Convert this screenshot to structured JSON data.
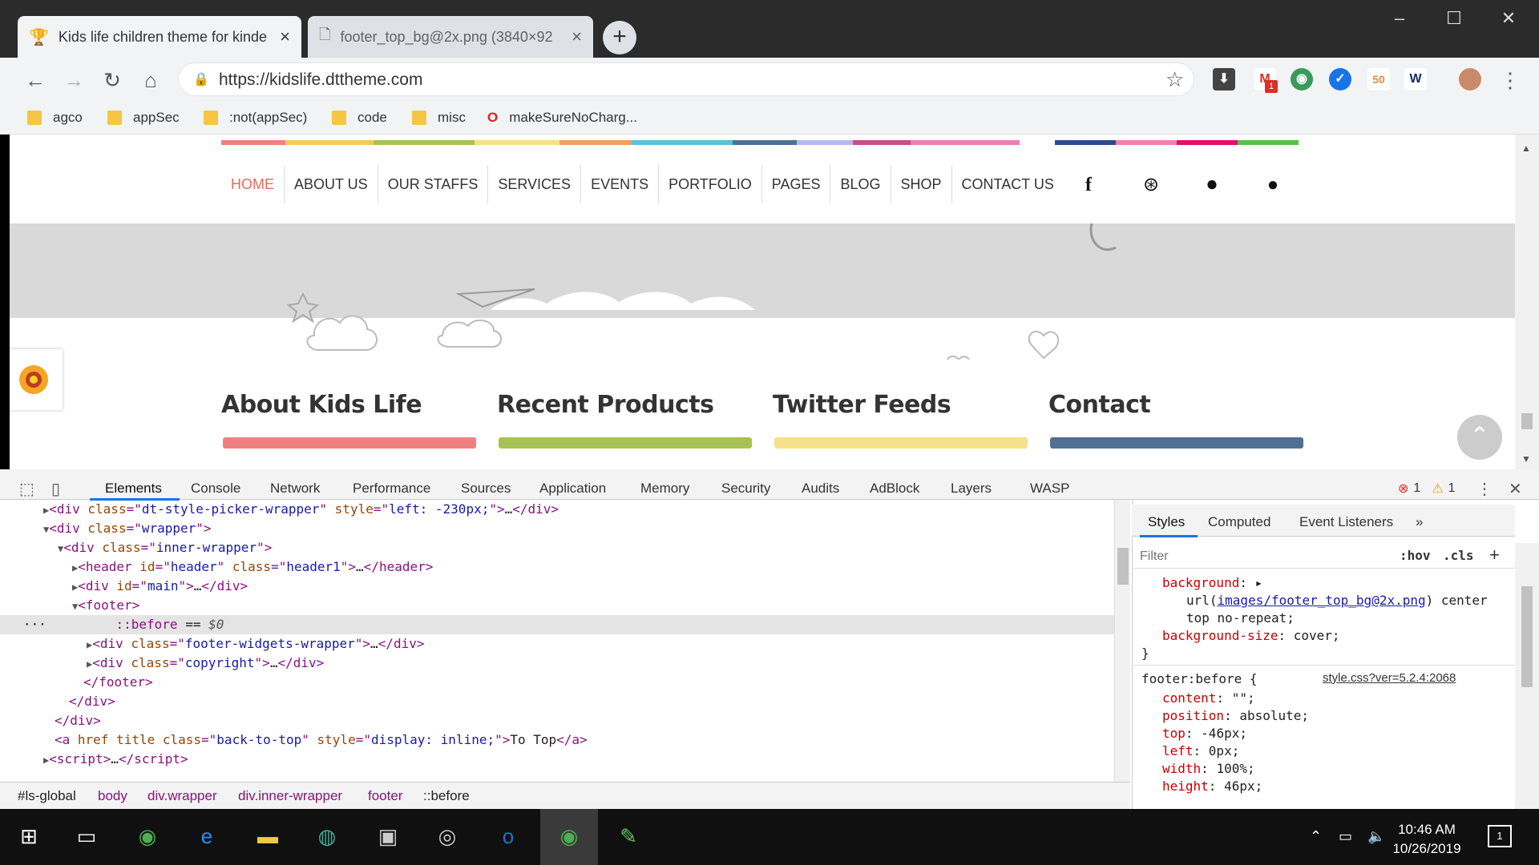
{
  "browser": {
    "tabs": [
      {
        "title": "Kids life children theme for kinde"
      },
      {
        "title": "footer_top_bg@2x.png (3840×92"
      }
    ],
    "url": "https://kidslife.dttheme.com",
    "bookmarks": [
      "agco",
      "appSec",
      ":not(appSec)",
      "code",
      "misc",
      "makeSureNoCharg..."
    ],
    "ext_badge": "1"
  },
  "site": {
    "nav": [
      "HOME",
      "ABOUT US",
      "OUR STAFFS",
      "SERVICES",
      "EVENTS",
      "PORTFOLIO",
      "PAGES",
      "BLOG",
      "SHOP",
      "CONTACT US"
    ],
    "footer_headings": [
      "About Kids Life",
      "Recent Products",
      "Twitter Feeds",
      "Contact"
    ],
    "colors": {
      "accent": "#e86a5a",
      "bar_red": "#f08080",
      "bar_green": "#a8c256",
      "bar_yellow": "#f7e08a",
      "bar_blue": "#4f6f94"
    }
  },
  "devtools": {
    "tabs": [
      "Elements",
      "Console",
      "Network",
      "Performance",
      "Sources",
      "Application",
      "Memory",
      "Security",
      "Audits",
      "AdBlock",
      "Layers",
      "WASP"
    ],
    "errors": "1",
    "warnings": "1",
    "breadcrumbs": [
      "#ls-global",
      "body",
      "div.wrapper",
      "div.inner-wrapper",
      "footer",
      "::before"
    ],
    "styles_tabs": [
      "Styles",
      "Computed",
      "Event Listeners"
    ],
    "filter_placeholder": "Filter",
    "hov": ":hov",
    "cls": ".cls",
    "rule_source": "style.css?ver=5.2.4:2068",
    "rule_selector": "footer:before {",
    "bg_url": "images/footer_top_bg@2x.png"
  },
  "taskbar": {
    "time": "10:46 AM",
    "date": "10/26/2019",
    "notif": "1"
  }
}
